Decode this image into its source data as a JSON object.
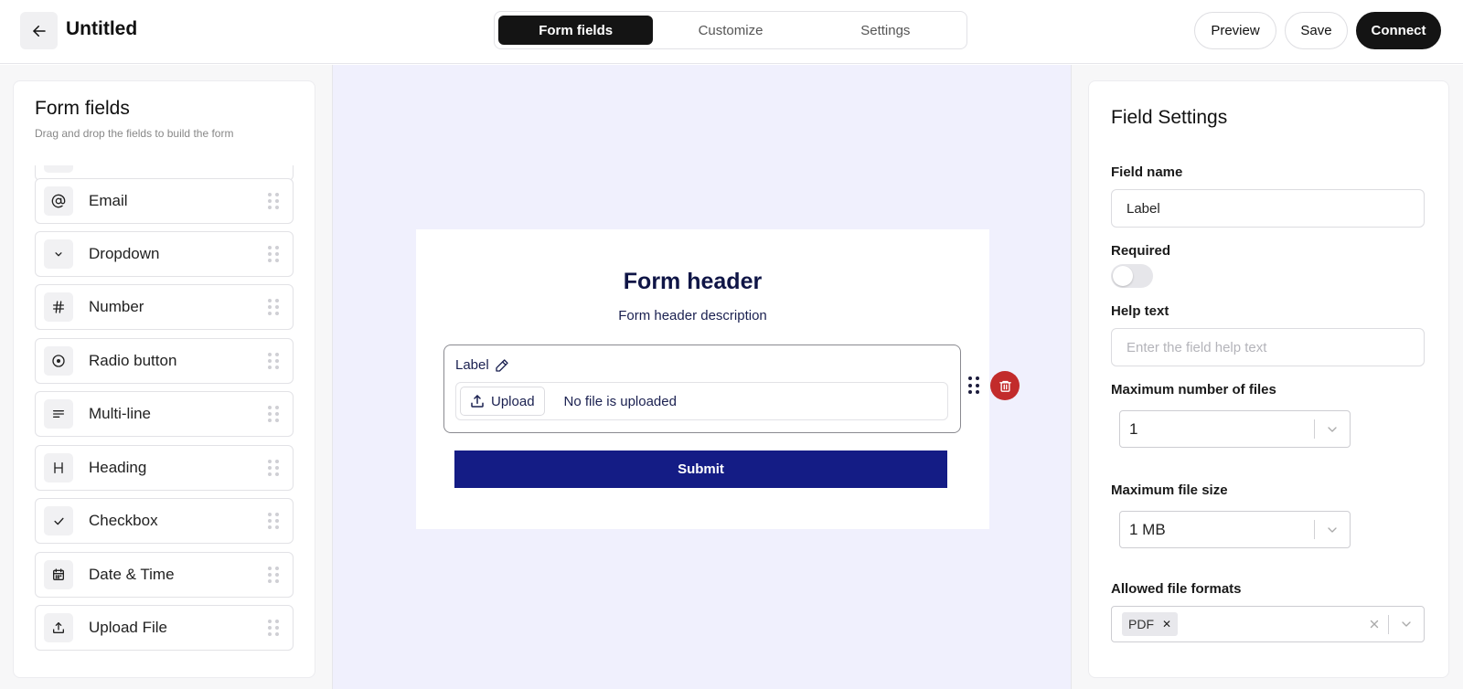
{
  "header": {
    "title": "Untitled",
    "tabs": [
      {
        "label": "Form fields",
        "active": true
      },
      {
        "label": "Customize",
        "active": false
      },
      {
        "label": "Settings",
        "active": false
      }
    ],
    "actions": {
      "preview": "Preview",
      "save": "Save",
      "connect": "Connect"
    }
  },
  "left_panel": {
    "title": "Form fields",
    "subtitle": "Drag and drop the fields to build the form",
    "items": [
      {
        "label": "",
        "icon": "text-icon"
      },
      {
        "label": "Email",
        "icon": "at-icon"
      },
      {
        "label": "Dropdown",
        "icon": "chevron-down-icon"
      },
      {
        "label": "Number",
        "icon": "hash-icon"
      },
      {
        "label": "Radio button",
        "icon": "radio-icon"
      },
      {
        "label": "Multi-line",
        "icon": "lines-icon"
      },
      {
        "label": "Heading",
        "icon": "heading-icon"
      },
      {
        "label": "Checkbox",
        "icon": "check-icon"
      },
      {
        "label": "Date & Time",
        "icon": "calendar-icon"
      },
      {
        "label": "Upload File",
        "icon": "upload-icon"
      }
    ]
  },
  "canvas": {
    "form_header": "Form header",
    "form_description": "Form header description",
    "field": {
      "label": "Label",
      "upload_button": "Upload",
      "status": "No file is uploaded"
    },
    "submit": "Submit"
  },
  "field_settings": {
    "title": "Field Settings",
    "field_name_label": "Field name",
    "field_name_value": "Label",
    "required_label": "Required",
    "required_on": false,
    "help_text_label": "Help text",
    "help_text_placeholder": "Enter the field help text",
    "max_files_label": "Maximum number of files",
    "max_files_value": "1",
    "max_size_label": "Maximum file size",
    "max_size_value": "1 MB",
    "formats_label": "Allowed file formats",
    "formats": [
      "PDF"
    ]
  },
  "colors": {
    "accent_dark": "#141414",
    "submit_blue": "#141c85",
    "canvas_bg": "#f0f0fd",
    "delete_red": "#c22b2b",
    "form_text": "#0f1546"
  }
}
